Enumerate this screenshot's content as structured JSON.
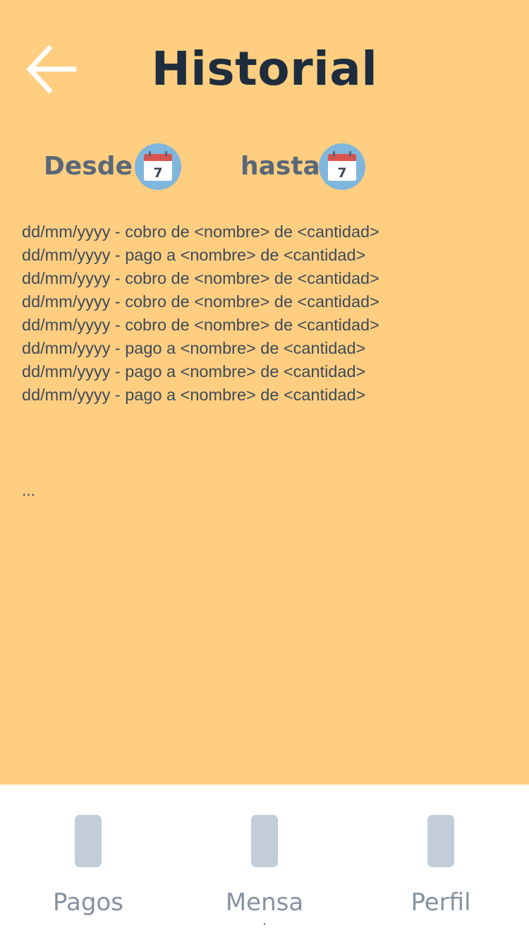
{
  "header": {
    "title": "Historial",
    "back_icon": "arrow-left-icon"
  },
  "filters": {
    "from_label": "Desde",
    "to_label": "hasta",
    "calendar_icon": "calendar-icon",
    "calendar_day": "7"
  },
  "history": {
    "entries": [
      "dd/mm/yyyy - cobro de <nombre> de <cantidad>",
      "dd/mm/yyyy - pago a <nombre> de <cantidad>",
      "dd/mm/yyyy - cobro de <nombre> de <cantidad>",
      "dd/mm/yyyy - cobro de <nombre> de <cantidad>",
      "dd/mm/yyyy - cobro de <nombre> de <cantidad>",
      "dd/mm/yyyy - pago a <nombre> de <cantidad>",
      "dd/mm/yyyy - pago a <nombre> de <cantidad>",
      "dd/mm/yyyy - pago a <nombre> de <cantidad>"
    ],
    "more": "..."
  },
  "bottom_nav": {
    "items": [
      {
        "label": "Pagos"
      },
      {
        "label": "Mensa"
      },
      {
        "label": "Perfil"
      }
    ]
  },
  "colors": {
    "background": "#ffce80",
    "title": "#1e2d3d",
    "nav_background": "#ffffff",
    "nav_icon": "#c3cdda",
    "calendar_circle": "#7fb6dc",
    "calendar_header": "#d9534f"
  }
}
